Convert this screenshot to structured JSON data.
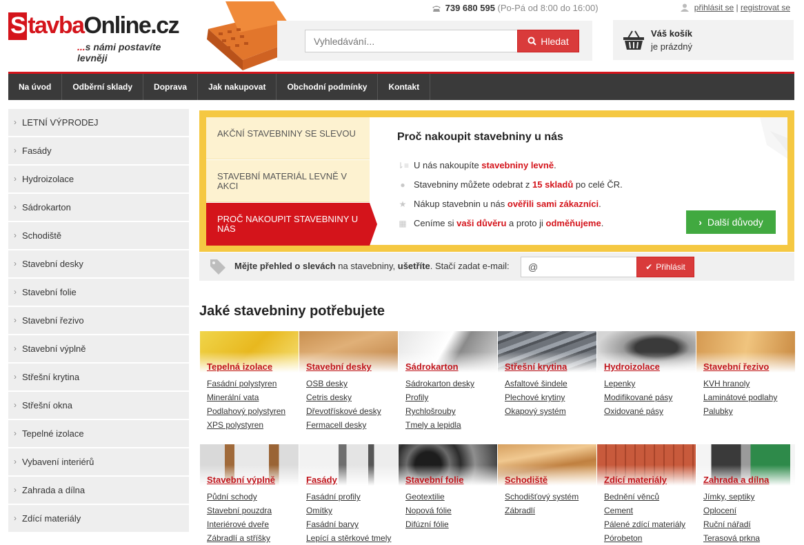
{
  "header": {
    "logo_box": "S",
    "logo_red": "tavba",
    "logo_rest": "Online.cz",
    "slogan_dots": "...",
    "slogan": "s námi postavíte levněji",
    "phone_number": "739 680 595",
    "phone_hours": "(Po-Pá od 8:00 do 16:00)",
    "login": "přihlásit se",
    "separator": "|",
    "register": "registrovat se",
    "search_placeholder": "Vyhledávání...",
    "search_button": "Hledat",
    "cart_title": "Váš košík",
    "cart_status": "je prázdný"
  },
  "nav": [
    "Na úvod",
    "Odběrní sklady",
    "Doprava",
    "Jak nakupovat",
    "Obchodní podmínky",
    "Kontakt"
  ],
  "sidebar": [
    "LETNÍ VÝPRODEJ",
    "Fasády",
    "Hydroizolace",
    "Sádrokarton",
    "Schodiště",
    "Stavební desky",
    "Stavební folie",
    "Stavební řezivo",
    "Stavební výplně",
    "Střešní krytina",
    "Střešní okna",
    "Tepelné izolace",
    "Vybavení interiérů",
    "Zahrada a dílna",
    "Zdící materiály"
  ],
  "promo": {
    "tabs": [
      "AKČNÍ STAVEBNINY SE SLEVOU",
      "STAVEBNÍ MATERIÁL LEVNĚ V AKCI",
      "PROČ NAKOUPIT STAVEBNINY U NÁS"
    ],
    "title": "Proč nakoupit stavebniny u nás",
    "l1_a": "U nás nakoupíte ",
    "l1_b": "stavebniny levně",
    "l1_c": ".",
    "l2_a": "Stavebniny můžete odebrat z ",
    "l2_b": "15 skladů",
    "l2_c": " po celé ČR.",
    "l3_a": "Nákup stavebnin u nás ",
    "l3_b": "ověřili sami zákazníci",
    "l3_c": ".",
    "l4_a": "Ceníme si ",
    "l4_b": "vaši důvěru",
    "l4_c": " a proto ji ",
    "l4_d": "odměňujeme",
    "l4_e": ".",
    "more_button": "Další důvody"
  },
  "newsletter": {
    "t1": "Mějte přehled o slevách",
    "t2": " na stavebniny, ",
    "t3": "ušetříte",
    "t4": ". Stačí zadat e-mail:",
    "input_value": "@",
    "button": "Přihlásit"
  },
  "categories_heading": "Jaké stavebniny potřebujete",
  "categories": [
    {
      "title": "Tepelná izolace",
      "links": [
        "Fasádní polystyren",
        "Minerální vata",
        "Podlahový polystyren",
        "XPS polystyren"
      ]
    },
    {
      "title": "Stavební desky",
      "links": [
        "OSB desky",
        "Cetris desky",
        "Dřevotřískové desky",
        "Fermacell desky"
      ]
    },
    {
      "title": "Sádrokarton",
      "links": [
        "Sádrokarton desky",
        "Profily",
        "Rychlošrouby",
        "Tmely a lepidla"
      ]
    },
    {
      "title": "Střešní krytina",
      "links": [
        "Asfaltové šindele",
        "Plechové krytiny",
        "Okapový systém"
      ]
    },
    {
      "title": "Hydroizolace",
      "links": [
        "Lepenky",
        "Modifikované pásy",
        "Oxidované pásy"
      ]
    },
    {
      "title": "Stavební řezivo",
      "links": [
        "KVH hranoly",
        "Laminátové podlahy",
        "Palubky"
      ]
    },
    {
      "title": "Stavební výplně",
      "links": [
        "Půdní schody",
        "Stavební pouzdra",
        "Interiérové dveře",
        "Zábradlí a stříšky"
      ]
    },
    {
      "title": "Fasády",
      "links": [
        "Fasádní profily",
        "Omítky",
        "Fasádní barvy",
        "Lepící a stěrkové tmely"
      ]
    },
    {
      "title": "Stavební folie",
      "links": [
        "Geotextilie",
        "Nopová fólie",
        "Difúzní fólie"
      ]
    },
    {
      "title": "Schodiště",
      "links": [
        "Schodišťový systém",
        "Zábradlí"
      ]
    },
    {
      "title": "Zdící materiály",
      "links": [
        "Bednění věnců",
        "Cement",
        "Pálené zdící materiály",
        "Pórobeton"
      ]
    },
    {
      "title": "Zahrada a dílna",
      "links": [
        "Jímky, septiky",
        "Oplocení",
        "Ruční nářadí",
        "Terasová prkna"
      ]
    }
  ],
  "colors": {
    "brand_red": "#d4141b",
    "nav_bg": "#3a3a3a",
    "promo_yellow": "#f5c842",
    "green": "#41a940"
  }
}
